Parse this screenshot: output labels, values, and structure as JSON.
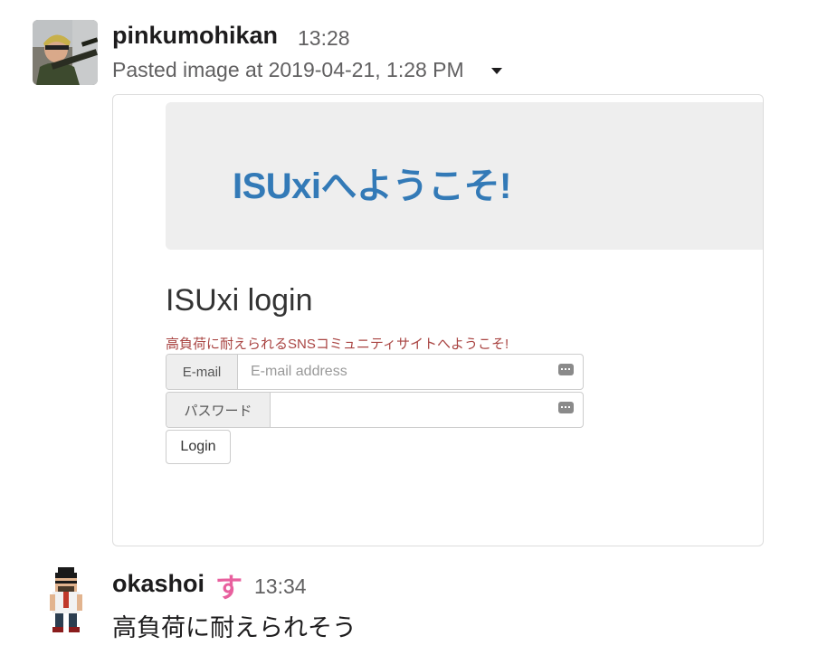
{
  "messages": [
    {
      "author": "pinkumohikan",
      "time": "13:28",
      "file_meta": "Pasted image at 2019-04-21, 1:28 PM",
      "attachment": {
        "jumbotron_title": "ISUxiへようこそ!",
        "login_heading": "ISUxi login",
        "tagline": "高負荷に耐えられるSNSコミュニティサイトへようこそ!",
        "email_label": "E-mail",
        "email_placeholder": "E-mail address",
        "email_value": "",
        "password_label": "パスワード",
        "password_value": "",
        "login_button": "Login",
        "icons": [
          "keyboard-icon",
          "keyboard-icon"
        ]
      }
    },
    {
      "author": "okashoi",
      "reaction": "す",
      "time": "13:34",
      "text": "高負荷に耐えられそう"
    }
  ],
  "colors": {
    "link_blue": "#337ab7",
    "error_red": "#a94442",
    "reaction_pink": "#e8609e"
  }
}
